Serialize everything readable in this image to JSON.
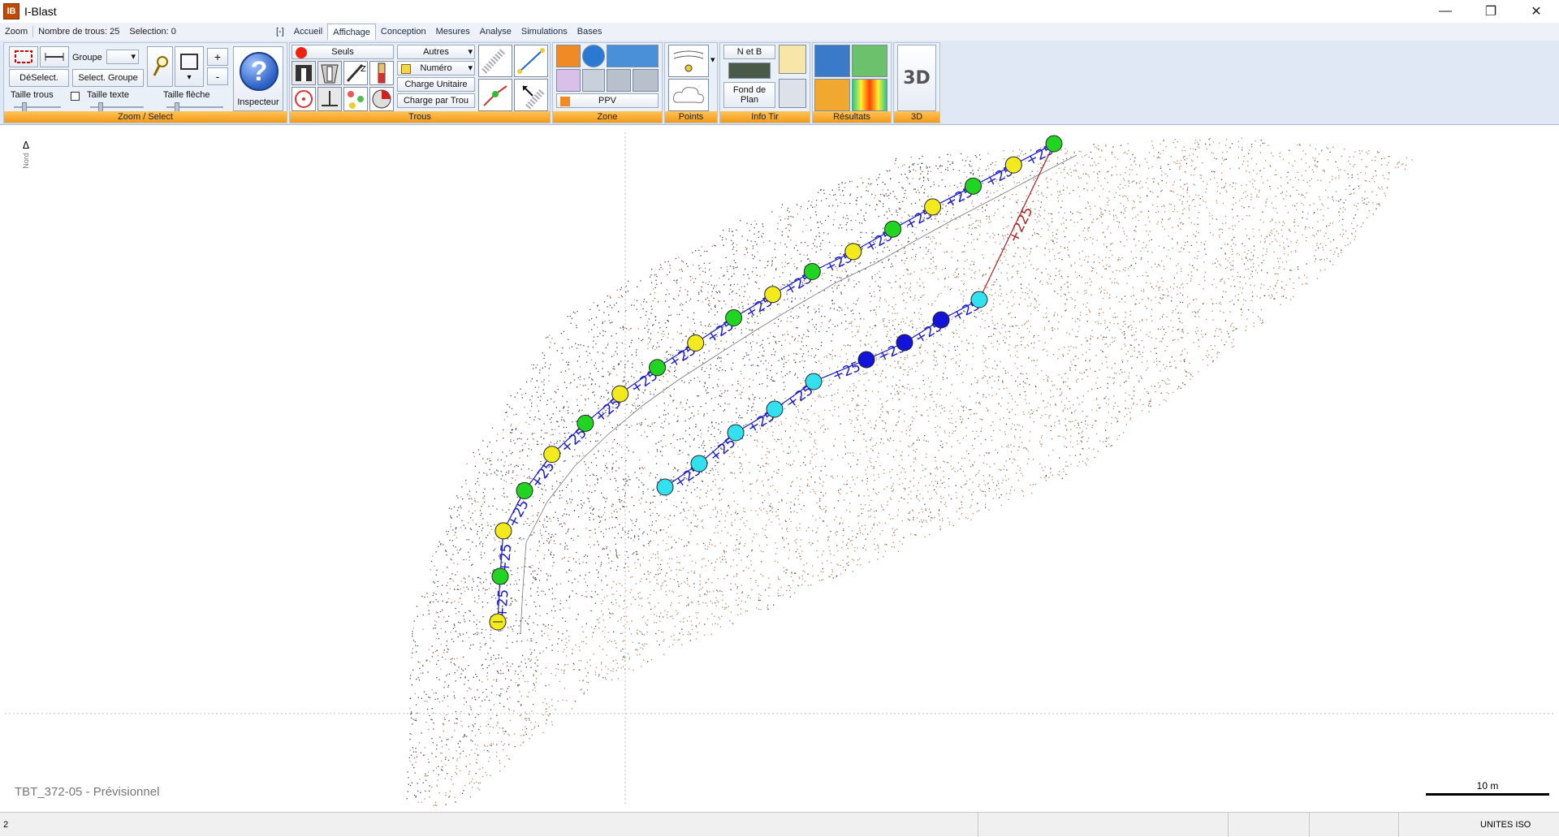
{
  "window": {
    "title": "I-Blast",
    "logo_text": "IB",
    "buttons": {
      "minimize": "—",
      "maximize": "❐",
      "close": "✕"
    }
  },
  "menubar": {
    "zoom_label": "Zoom",
    "holes_count": "Nombre de trous: 25",
    "selection": "Selection: 0",
    "collapse": "[-]",
    "tabs": [
      "Accueil",
      "Affichage",
      "Conception",
      "Mesures",
      "Analyse",
      "Simulations",
      "Bases"
    ],
    "active_tab": "Affichage"
  },
  "ribbon": {
    "zoom_select": {
      "label": "Zoom / Select",
      "deselect": "DéSelect.",
      "groupe": "Groupe",
      "select_groupe": "Select. Groupe",
      "plus": "+",
      "minus": "-",
      "taille_trous": "Taille trous",
      "taille_texte": "Taille texte",
      "taille_fleche": "Taille flèche",
      "inspecteur": "Inspecteur",
      "help_glyph": "?"
    },
    "trous": {
      "label": "Trous",
      "seuls": "Seuls",
      "autres": "Autres",
      "numero": "Numéro",
      "charge_unitaire": "Charge Unitaire",
      "charge_par_trou": "Charge par Trou"
    },
    "zone": {
      "label": "Zone",
      "ppv": "PPV"
    },
    "points": {
      "label": "Points"
    },
    "info_tir": {
      "label": "Info Tir",
      "n_et_b": "N et B",
      "fond_de_plan": "Fond de Plan"
    },
    "resultats": {
      "label": "Résultats"
    },
    "view3d": {
      "label": "3D",
      "badge": "3D"
    }
  },
  "canvas": {
    "north_label": "Nord",
    "blast_name": "TBT_372-05 - Prévisionnel",
    "scale_label": "10 m",
    "delay_label": "+25",
    "main_delay_label": "+225",
    "colors": {
      "green": "#22d422",
      "yellow": "#f2ea1c",
      "cyan": "#33e0f0",
      "blue": "#1414d8",
      "delay_text": "#1a1acc",
      "main_line": "#aa2222"
    },
    "holes_top_row": [
      {
        "c": "yellow"
      },
      {
        "c": "green"
      },
      {
        "c": "yellow"
      },
      {
        "c": "green"
      },
      {
        "c": "yellow"
      },
      {
        "c": "green"
      },
      {
        "c": "yellow"
      },
      {
        "c": "green"
      },
      {
        "c": "yellow"
      },
      {
        "c": "green"
      },
      {
        "c": "yellow"
      },
      {
        "c": "green"
      },
      {
        "c": "yellow"
      },
      {
        "c": "green"
      },
      {
        "c": "yellow"
      },
      {
        "c": "green"
      },
      {
        "c": "yellow"
      },
      {
        "c": "green"
      }
    ],
    "holes_bottom_row": [
      {
        "c": "cyan"
      },
      {
        "c": "cyan"
      },
      {
        "c": "cyan"
      },
      {
        "c": "cyan"
      },
      {
        "c": "cyan"
      },
      {
        "c": "blue"
      },
      {
        "c": "blue"
      },
      {
        "c": "blue"
      },
      {
        "c": "cyan"
      }
    ]
  },
  "statusbar": {
    "left": "2",
    "units": "UNITES ISO"
  }
}
